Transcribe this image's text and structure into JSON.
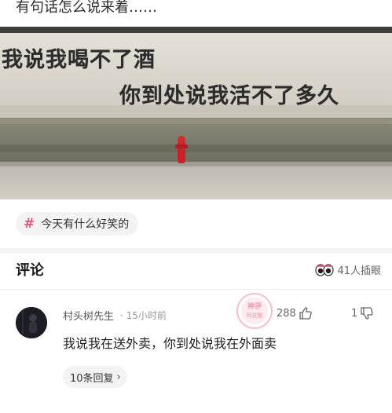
{
  "post": {
    "text": "有句话怎么说来着……"
  },
  "meme": {
    "line1": "我说我喝不了酒",
    "line2": "你到处说我活不了多久"
  },
  "topic": {
    "hash": "#",
    "label": "今天有什么好笑的"
  },
  "comments_header": {
    "title": "评论",
    "insert_count": "41人插眼",
    "icon": "eyes-icon"
  },
  "comment": {
    "author": "村头树先生",
    "time": "· 15小时前",
    "likes": "288",
    "dislikes": "1",
    "text": "我说我在送外卖，你到处说我在外面卖",
    "replies_label": "10条回复",
    "replies_chevron": "›"
  },
  "watermark": {
    "line1": "神评",
    "line2": "阿皮蟹"
  },
  "colors": {
    "accent_pink": "#f0557a",
    "wall": "#d9d6cc",
    "road": "#c6c2b7"
  }
}
